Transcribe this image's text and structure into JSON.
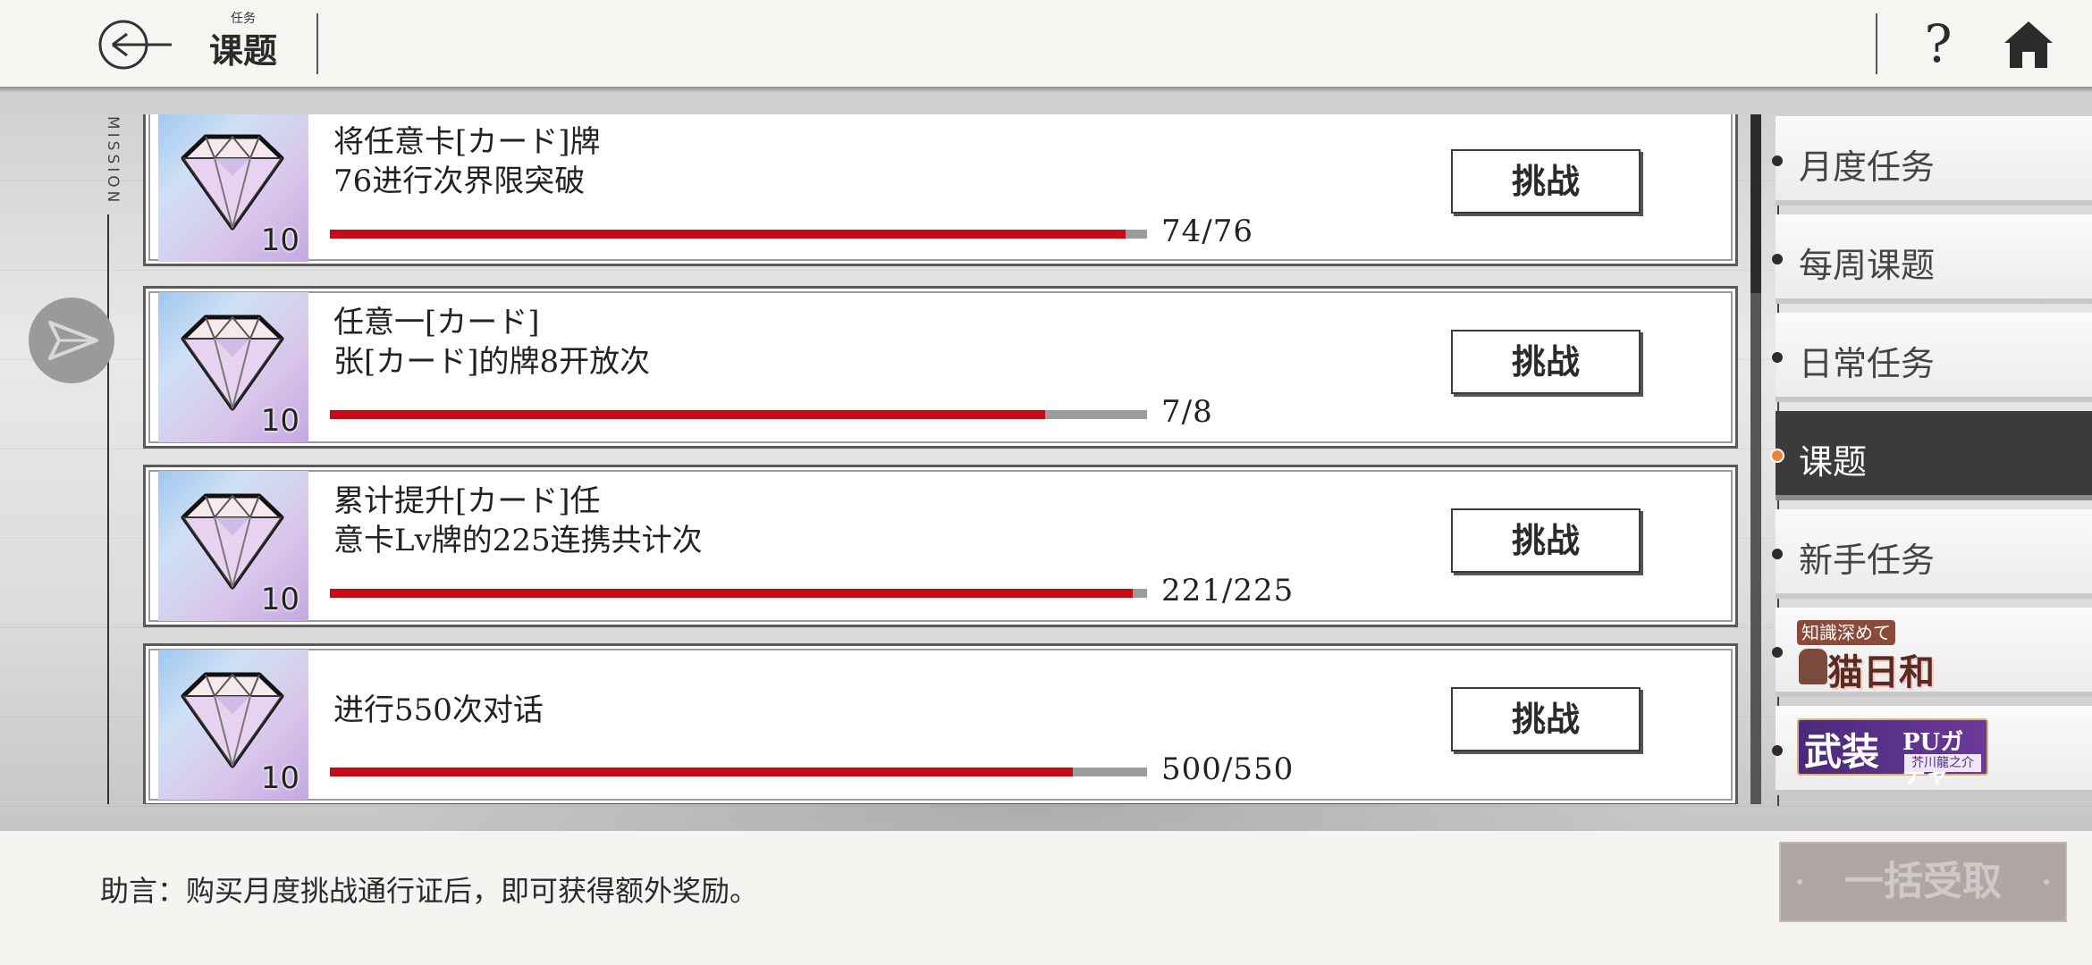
{
  "header": {
    "title_small": "任务",
    "title": "课题",
    "help_symbol": "?"
  },
  "side_label": "MISSION",
  "tasks": [
    {
      "line1": "将任意卡[カード]牌",
      "line2": "76进行次界限突破",
      "reward_count": "10",
      "progress_text": "74/76",
      "progress_fraction": 0.974,
      "button": "挑战"
    },
    {
      "line1": "任意一[カード]",
      "line2": "张[カード]的牌8开放次",
      "reward_count": "10",
      "progress_text": "7/8",
      "progress_fraction": 0.875,
      "button": "挑战"
    },
    {
      "line1": "累计提升[カード]任",
      "line2": "意卡Lv牌的225连携共计次",
      "reward_count": "10",
      "progress_text": "221/225",
      "progress_fraction": 0.982,
      "button": "挑战"
    },
    {
      "line1": "进行550次对话",
      "line2": "",
      "reward_count": "10",
      "progress_text": "500/550",
      "progress_fraction": 0.909,
      "button": "挑战"
    }
  ],
  "side_menu": [
    {
      "label": "月度任务",
      "active": false
    },
    {
      "label": "每周课题",
      "active": false
    },
    {
      "label": "日常任务",
      "active": false
    },
    {
      "label": "课题",
      "active": true
    },
    {
      "label": "新手任务",
      "active": false
    }
  ],
  "banners": {
    "cat": {
      "top": "知識深めて",
      "main": "猫日和"
    },
    "arms": {
      "main": "武装",
      "pu": "PUガチャ",
      "name": "芥川龍之介"
    }
  },
  "footer": {
    "hint": "助言：购买月度挑战通行证后，即可获得额外奖励。",
    "collect_button": "一括受取"
  },
  "colors": {
    "progress_fill": "#c40d16",
    "active_tab": "#3b3b3b",
    "active_dot": "#f0803c"
  }
}
